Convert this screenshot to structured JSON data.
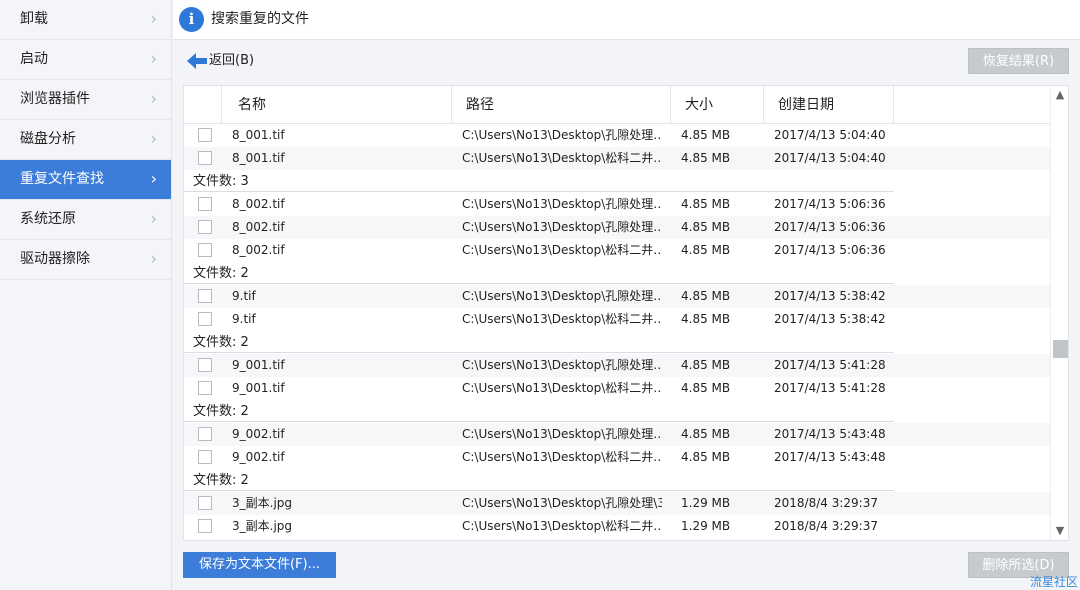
{
  "sidebar": {
    "items": [
      {
        "label": "卸载",
        "active": false
      },
      {
        "label": "启动",
        "active": false
      },
      {
        "label": "浏览器插件",
        "active": false
      },
      {
        "label": "磁盘分析",
        "active": false
      },
      {
        "label": "重复文件查找",
        "active": true
      },
      {
        "label": "系统还原",
        "active": false
      },
      {
        "label": "驱动器擦除",
        "active": false
      }
    ]
  },
  "header": {
    "info_glyph": "i",
    "title": "搜索重复的文件"
  },
  "toolbar": {
    "back_label": "返回(B)",
    "restore_label": "恢复结果(R)"
  },
  "table": {
    "columns": {
      "name": "名称",
      "path": "路径",
      "size": "大小",
      "date": "创建日期"
    },
    "rows": [
      {
        "type": "file",
        "name": "8_001.tif",
        "path": "C:\\Users\\No13\\Desktop\\孔隙处理…",
        "size": "4.85 MB",
        "date": "2017/4/13 5:04:40"
      },
      {
        "type": "file",
        "name": "8_001.tif",
        "path": "C:\\Users\\No13\\Desktop\\松科二井…",
        "size": "4.85 MB",
        "date": "2017/4/13 5:04:40"
      },
      {
        "type": "group",
        "label": "文件数: 3"
      },
      {
        "type": "file",
        "name": "8_002.tif",
        "path": "C:\\Users\\No13\\Desktop\\孔隙处理…",
        "size": "4.85 MB",
        "date": "2017/4/13 5:06:36"
      },
      {
        "type": "file",
        "name": "8_002.tif",
        "path": "C:\\Users\\No13\\Desktop\\孔隙处理…",
        "size": "4.85 MB",
        "date": "2017/4/13 5:06:36"
      },
      {
        "type": "file",
        "name": "8_002.tif",
        "path": "C:\\Users\\No13\\Desktop\\松科二井…",
        "size": "4.85 MB",
        "date": "2017/4/13 5:06:36"
      },
      {
        "type": "group",
        "label": "文件数: 2"
      },
      {
        "type": "file",
        "name": "9.tif",
        "path": "C:\\Users\\No13\\Desktop\\孔隙处理…",
        "size": "4.85 MB",
        "date": "2017/4/13 5:38:42"
      },
      {
        "type": "file",
        "name": "9.tif",
        "path": "C:\\Users\\No13\\Desktop\\松科二井…",
        "size": "4.85 MB",
        "date": "2017/4/13 5:38:42"
      },
      {
        "type": "group",
        "label": "文件数: 2"
      },
      {
        "type": "file",
        "name": "9_001.tif",
        "path": "C:\\Users\\No13\\Desktop\\孔隙处理…",
        "size": "4.85 MB",
        "date": "2017/4/13 5:41:28"
      },
      {
        "type": "file",
        "name": "9_001.tif",
        "path": "C:\\Users\\No13\\Desktop\\松科二井…",
        "size": "4.85 MB",
        "date": "2017/4/13 5:41:28"
      },
      {
        "type": "group",
        "label": "文件数: 2"
      },
      {
        "type": "file",
        "name": "9_002.tif",
        "path": "C:\\Users\\No13\\Desktop\\孔隙处理…",
        "size": "4.85 MB",
        "date": "2017/4/13 5:43:48"
      },
      {
        "type": "file",
        "name": "9_002.tif",
        "path": "C:\\Users\\No13\\Desktop\\松科二井…",
        "size": "4.85 MB",
        "date": "2017/4/13 5:43:48"
      },
      {
        "type": "group",
        "label": "文件数: 2"
      },
      {
        "type": "file",
        "name": "3_副本.jpg",
        "path": "C:\\Users\\No13\\Desktop\\孔隙处理\\3",
        "size": "1.29 MB",
        "date": "2018/8/4 3:29:37"
      },
      {
        "type": "file",
        "name": "3_副本.jpg",
        "path": "C:\\Users\\No13\\Desktop\\松科二井…",
        "size": "1.29 MB",
        "date": "2018/8/4 3:29:37"
      }
    ]
  },
  "footer": {
    "save_label": "保存为文本文件(F)...",
    "delete_label": "删除所选(D)"
  },
  "watermark": "流星社区",
  "colors": {
    "accent": "#3b7dd8",
    "disabled_button": "#c7cacf",
    "info_icon": "#2d78d8"
  }
}
